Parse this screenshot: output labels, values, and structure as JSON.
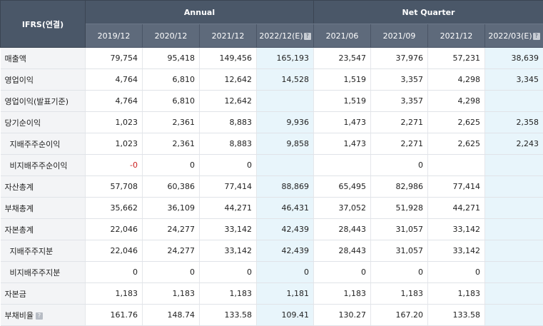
{
  "header": {
    "corner": "IFRS(연결)",
    "groups": {
      "annual": "Annual",
      "quarter": "Net Quarter"
    },
    "periods": [
      "2019/12",
      "2020/12",
      "2021/12",
      "2022/12(E)",
      "2021/06",
      "2021/09",
      "2021/12",
      "2022/03(E)"
    ],
    "help_glyph": "?"
  },
  "rows": [
    {
      "label": "매출액",
      "values": [
        "79,754",
        "95,418",
        "149,456",
        "165,193",
        "23,547",
        "37,976",
        "57,231",
        "38,639"
      ]
    },
    {
      "label": "영업이익",
      "values": [
        "4,764",
        "6,810",
        "12,642",
        "14,528",
        "1,519",
        "3,357",
        "4,298",
        "3,345"
      ]
    },
    {
      "label": "영업이익(발표기준)",
      "values": [
        "4,764",
        "6,810",
        "12,642",
        "",
        "1,519",
        "3,357",
        "4,298",
        ""
      ]
    },
    {
      "label": "당기순이익",
      "values": [
        "1,023",
        "2,361",
        "8,883",
        "9,936",
        "1,473",
        "2,271",
        "2,625",
        "2,358"
      ]
    },
    {
      "label": "지배주주순이익",
      "values": [
        "1,023",
        "2,361",
        "8,883",
        "9,858",
        "1,473",
        "2,271",
        "2,625",
        "2,243"
      ]
    },
    {
      "label": "비지배주주순이익",
      "values": [
        "-0",
        "0",
        "0",
        "",
        "",
        "0",
        "",
        ""
      ]
    },
    {
      "label": "자산총계",
      "values": [
        "57,708",
        "60,386",
        "77,414",
        "88,869",
        "65,495",
        "82,986",
        "77,414",
        ""
      ]
    },
    {
      "label": "부채총계",
      "values": [
        "35,662",
        "36,109",
        "44,271",
        "46,431",
        "37,052",
        "51,928",
        "44,271",
        ""
      ]
    },
    {
      "label": "자본총계",
      "values": [
        "22,046",
        "24,277",
        "33,142",
        "42,439",
        "28,443",
        "31,057",
        "33,142",
        ""
      ]
    },
    {
      "label": "지배주주지분",
      "values": [
        "22,046",
        "24,277",
        "33,142",
        "42,439",
        "28,443",
        "31,057",
        "33,142",
        ""
      ]
    },
    {
      "label": "비지배주주지분",
      "values": [
        "0",
        "0",
        "0",
        "0",
        "0",
        "0",
        "0",
        ""
      ]
    },
    {
      "label": "자본금",
      "values": [
        "1,183",
        "1,183",
        "1,183",
        "1,181",
        "1,183",
        "1,183",
        "1,183",
        ""
      ]
    },
    {
      "label": "부채비율",
      "values": [
        "161.76",
        "148.74",
        "133.58",
        "109.41",
        "130.27",
        "167.20",
        "133.58",
        ""
      ]
    }
  ],
  "colors": {
    "header_bg": "#4a5768",
    "subheader_bg": "#5e6a7b",
    "label_bg": "#f3f4f6",
    "estimate_bg": "#e8f5fb",
    "negative_text": "#cc2222"
  }
}
